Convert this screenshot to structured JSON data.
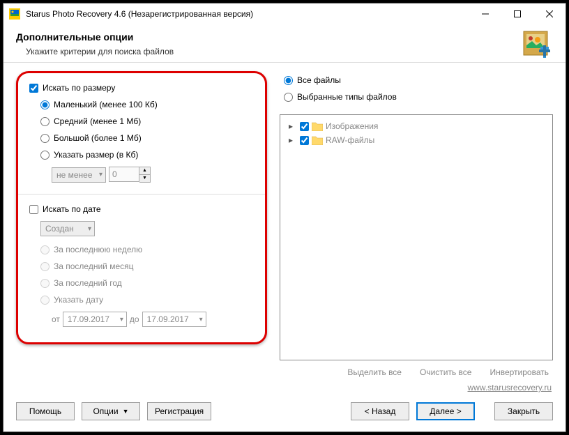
{
  "title": "Starus Photo Recovery 4.6 (Незарегистрированная версия)",
  "header": {
    "title": "Дополнительные опции",
    "subtitle": "Укажите критерии для поиска файлов"
  },
  "size": {
    "enable_label": "Искать по размеру",
    "opts": {
      "small": "Маленький (менее 100 Кб)",
      "medium": "Средний (менее 1 Мб)",
      "large": "Большой (более 1 Мб)",
      "custom": "Указать размер (в Кб)"
    },
    "combo": "не менее",
    "spinner_value": "0"
  },
  "date": {
    "enable_label": "Искать по дате",
    "combo": "Создан",
    "opts": {
      "week": "За последнюю неделю",
      "month": "За последний месяц",
      "year": "За последний год",
      "custom": "Указать дату"
    },
    "from_label": "от",
    "from_value": "17.09.2017",
    "to_label": "до",
    "to_value": "17.09.2017"
  },
  "filetypes": {
    "all_label": "Все файлы",
    "selected_label": "Выбранные типы файлов",
    "tree": {
      "images": "Изображения",
      "raw": "RAW-файлы"
    }
  },
  "selection": {
    "select_all": "Выделить все",
    "clear_all": "Очистить все",
    "invert": "Инвертировать"
  },
  "site": "www.starusrecovery.ru",
  "buttons": {
    "help": "Помощь",
    "options": "Опции",
    "register": "Регистрация",
    "back": "< Назад",
    "next": "Далее >",
    "close": "Закрыть"
  }
}
